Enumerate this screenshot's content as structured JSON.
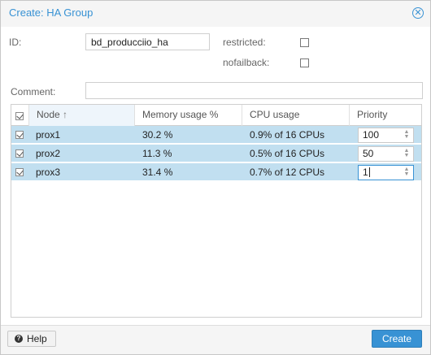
{
  "window": {
    "title": "Create: HA Group",
    "close_icon": "close-circle-icon"
  },
  "form": {
    "id_label": "ID:",
    "id_value": "bd_producciio_ha",
    "restricted_label": "restricted:",
    "restricted_checked": false,
    "nofailback_label": "nofailback:",
    "nofailback_checked": false,
    "comment_label": "Comment:",
    "comment_value": ""
  },
  "grid": {
    "columns": {
      "node": "Node",
      "sort_icon": "↑",
      "memory": "Memory usage %",
      "cpu": "CPU usage",
      "priority": "Priority"
    },
    "rows": [
      {
        "selected": true,
        "node": "prox1",
        "memory": "30.2 %",
        "cpu": "0.9% of 16 CPUs",
        "priority": "100"
      },
      {
        "selected": true,
        "node": "prox2",
        "memory": "11.3 %",
        "cpu": "0.5% of 16 CPUs",
        "priority": "50"
      },
      {
        "selected": true,
        "node": "prox3",
        "memory": "31.4 %",
        "cpu": "0.7% of 12 CPUs",
        "priority": "1"
      }
    ]
  },
  "footer": {
    "help_label": "Help",
    "help_icon": "question-circle-icon",
    "create_label": "Create"
  },
  "colors": {
    "accent": "#3892d4",
    "row_selected": "#c1dff0"
  }
}
